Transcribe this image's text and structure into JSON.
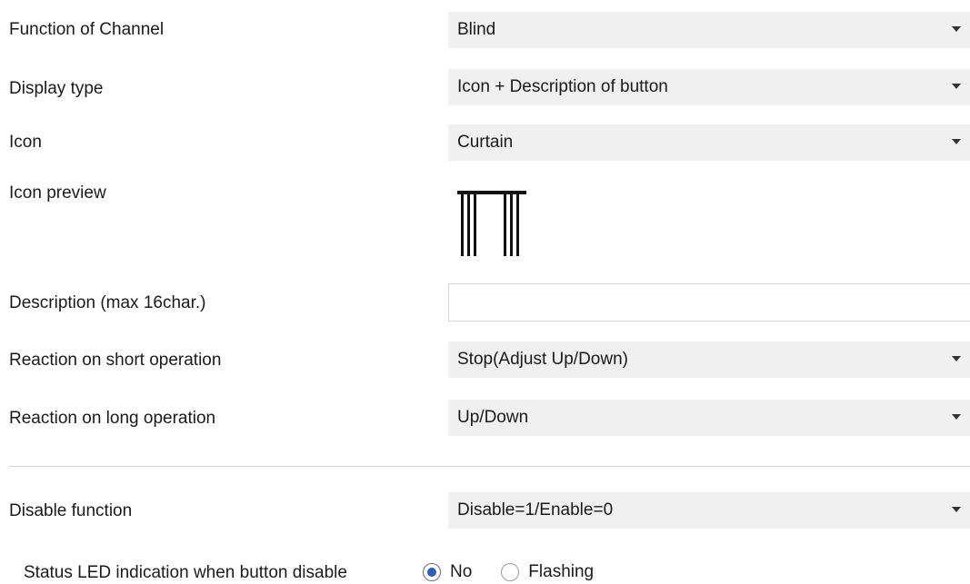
{
  "fields": {
    "function_of_channel": {
      "label": "Function of Channel",
      "value": "Blind"
    },
    "display_type": {
      "label": "Display type",
      "value": "Icon + Description of button"
    },
    "icon": {
      "label": "Icon",
      "value": "Curtain"
    },
    "icon_preview": {
      "label": "Icon preview",
      "icon": "curtain-icon"
    },
    "description": {
      "label": "Description (max 16char.)",
      "value": "",
      "placeholder": ""
    },
    "reaction_short": {
      "label": "Reaction on short operation",
      "value": "Stop(Adjust Up/Down)"
    },
    "reaction_long": {
      "label": "Reaction on long operation",
      "value": "Up/Down"
    },
    "disable_function": {
      "label": "Disable function",
      "value": "Disable=1/Enable=0"
    },
    "status_led": {
      "label": "Status LED indication when button disable",
      "options": [
        "No",
        "Flashing"
      ],
      "selected": "No"
    }
  },
  "colors": {
    "select_bg": "#f0f0f0",
    "radio_selected": "#2b5fb8",
    "text": "#1a1a1a"
  }
}
